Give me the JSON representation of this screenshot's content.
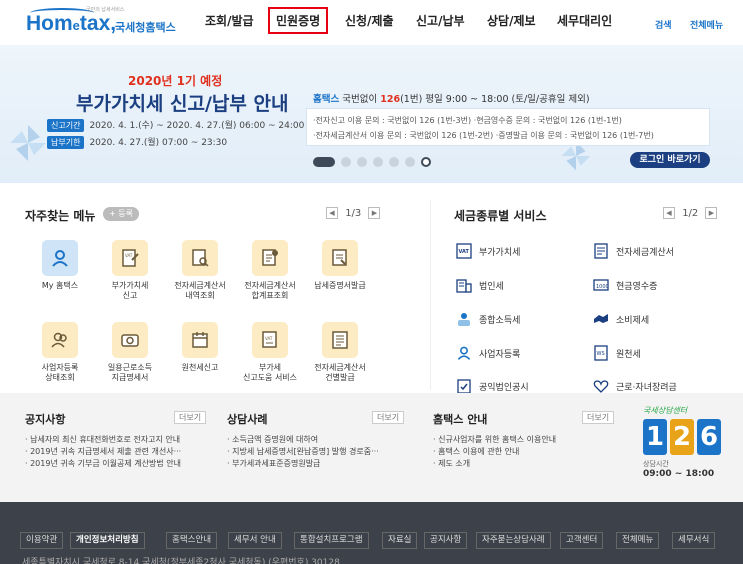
{
  "header": {
    "logo_tag": "국민의 납세서비스",
    "logo_brand_main": "Hom",
    "logo_brand_e": "e",
    "logo_brand_tail": "tax,",
    "logo_sub": "국세청홈택스",
    "nav": [
      "조회/발급",
      "민원증명",
      "신청/제출",
      "신고/납부",
      "상담/제보",
      "세무대리인"
    ],
    "search": "검색",
    "all_menu": "전체메뉴"
  },
  "banner": {
    "year": "2020년 1기 예정",
    "headline": "부가가치세 신고/납부 안내",
    "period_label": "신고기간",
    "period_value": "2020. 4. 1.(수) ~ 2020. 4. 27.(월) 06:00 ~ 24:00",
    "due_label": "납부기한",
    "due_value": "2020. 4. 27.(월) 07:00 ~ 23:30",
    "info_brand": "홈택스",
    "info_text1": " 국번없이 ",
    "info_num": "126",
    "info_text2": "(1번)  평일 9:00 ~ 18:00 (토/일/공휴일 제외)",
    "info_line1": "·전자신고 이용 문의 : 국번없이 126 (1번-3번)   ·현금영수증 문의 : 국번없이 126 (1번-1번)",
    "info_line2": "·전자세금계산서 이용 문의 : 국번없이 126 (1번-2번)   ·증명발급 이용 문의 : 국번없이 126 (1번-7번)",
    "login_button": "로그인 바로가기"
  },
  "quick_menu": {
    "title": "자주찾는 메뉴",
    "register": "+ 등록",
    "pager": "1/3",
    "items": [
      {
        "label": "My 홈택스",
        "icon": "person-icon"
      },
      {
        "label": "부가가치세\n신고",
        "icon": "vat-doc-icon"
      },
      {
        "label": "전자세금계산서\n내역조회",
        "icon": "invoice-search-icon"
      },
      {
        "label": "전자세금계산서\n합계표조회",
        "icon": "invoice-sum-icon"
      },
      {
        "label": "납세증명서발급",
        "icon": "certificate-icon"
      },
      {
        "label": "사업자등록\n상태조회",
        "icon": "business-person-icon"
      },
      {
        "label": "일용근로소득\n지급명세서",
        "icon": "wage-icon"
      },
      {
        "label": "원천세신고",
        "icon": "calendar-icon"
      },
      {
        "label": "부가세\n신고도움 서비스",
        "icon": "help-doc-icon"
      },
      {
        "label": "전자세금계산서\n건별발급",
        "icon": "issue-doc-icon"
      }
    ]
  },
  "tax_service": {
    "title": "세금종류별 서비스",
    "pager": "1/2",
    "items": [
      {
        "label": "부가가치세",
        "icon": "vat-icon"
      },
      {
        "label": "전자세금계산서",
        "icon": "e-invoice-icon"
      },
      {
        "label": "법인세",
        "icon": "corporate-icon"
      },
      {
        "label": "현금영수증",
        "icon": "receipt-icon"
      },
      {
        "label": "종합소득세",
        "icon": "income-icon"
      },
      {
        "label": "소비제세",
        "icon": "consumption-icon"
      },
      {
        "label": "사업자등록",
        "icon": "person-icon"
      },
      {
        "label": "원천세",
        "icon": "withholding-icon"
      },
      {
        "label": "공익법인공시",
        "icon": "disclosure-icon"
      },
      {
        "label": "근로·자녀장려금",
        "icon": "heart-icon"
      }
    ]
  },
  "notice": {
    "title": "공지사항",
    "more": "더보기",
    "items": [
      "납세자의 최신 휴대전화번호로 전자고지 안내",
      "2019년 귀속 지급명세서 제출 관련 개선사···",
      "2019년 귀속 기부금 이월공제 계산방법 안내"
    ]
  },
  "cases": {
    "title": "상담사례",
    "more": "더보기",
    "items": [
      "소득금액 증명원에 대하여",
      "지방세 납세증명서[완납증명] 발행 경로줌···",
      "부가세과세표준증명원발급"
    ]
  },
  "guide": {
    "title": "홈택스 안내",
    "more": "더보기",
    "items": [
      "신규사업자를 위한 홈택스 이용안내",
      "홈택스 이용에 관한 안내",
      "제도 소개"
    ]
  },
  "call_center": {
    "caption": "국세상담센터",
    "digits": [
      "1",
      "2",
      "6"
    ],
    "hours_label": "상담시간",
    "hours": "09:00 ~ 18:00"
  },
  "footer": {
    "links": [
      "이용약관",
      "개인정보처리방침",
      "홈택스안내",
      "세무서 안내",
      "통합설치프로그램",
      "자료실",
      "공지사항",
      "자주묻는상담사례",
      "고객센터",
      "전체메뉴",
      "세무서식"
    ],
    "address": "세종특별자치시 국세청로 8-14 국세청(정부세종2청사 국세청동) (우편번호) 30128"
  },
  "colors": {
    "brand": "#1c74c8",
    "accent_red": "#e0301e",
    "dark_navy": "#1b3f80",
    "footer_bg": "#3d4149"
  }
}
